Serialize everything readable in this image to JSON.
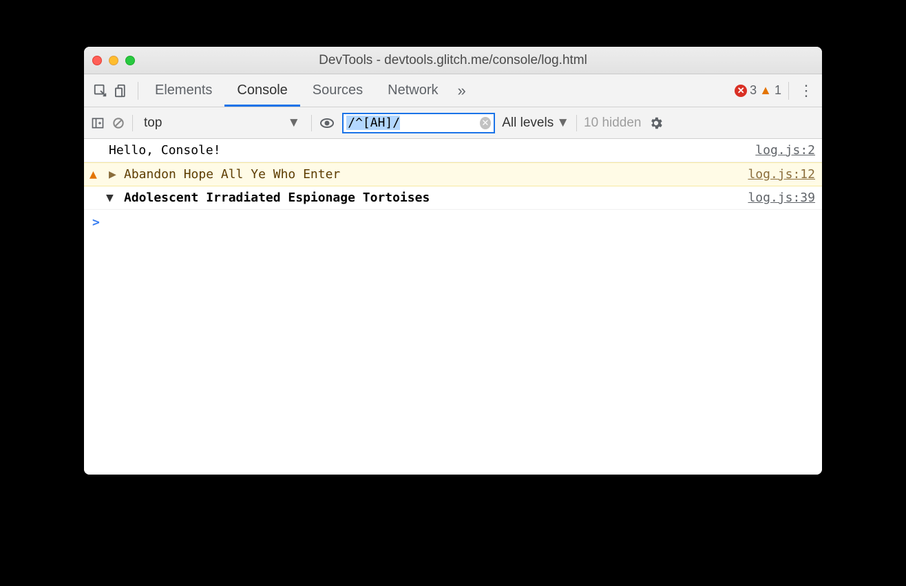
{
  "window": {
    "title": "DevTools - devtools.glitch.me/console/log.html"
  },
  "tabs": {
    "items": [
      "Elements",
      "Console",
      "Sources",
      "Network"
    ],
    "active": "Console",
    "errors": "3",
    "warnings": "1"
  },
  "toolbar": {
    "context": "top",
    "filter": "/^[AH]/",
    "levels": "All levels",
    "hidden": "10 hidden"
  },
  "logs": [
    {
      "text": "Hello, Console!",
      "src": "log.js:2",
      "type": "log"
    },
    {
      "text": "Abandon Hope All Ye Who Enter",
      "src": "log.js:12",
      "type": "warn",
      "disclosure": "right"
    },
    {
      "text": "Adolescent Irradiated Espionage Tortoises",
      "src": "log.js:39",
      "type": "group",
      "disclosure": "down"
    }
  ],
  "prompt": ">"
}
